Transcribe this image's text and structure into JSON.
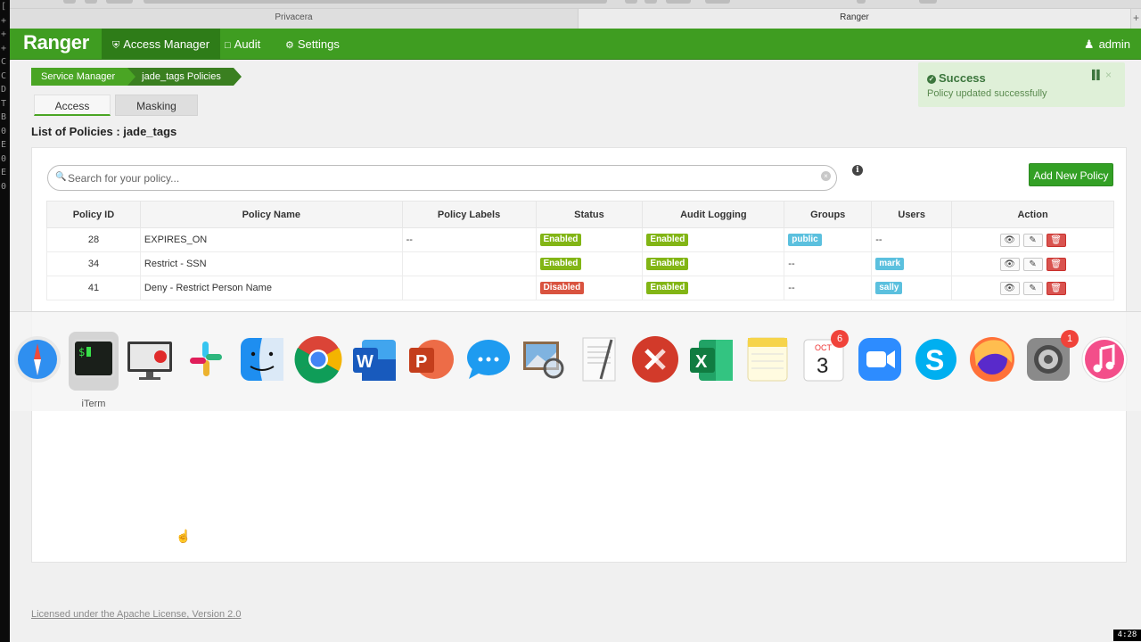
{
  "terminal": {
    "left_chars": [
      "[",
      "+",
      "+",
      "+",
      "C",
      "C",
      "D",
      "T",
      "B",
      "0",
      "E",
      "0",
      "E",
      "0"
    ]
  },
  "browser": {
    "tabs": [
      {
        "label": "Privacera"
      },
      {
        "label": "Ranger"
      }
    ],
    "new_tab_label": "+"
  },
  "navbar": {
    "brand": "Ranger",
    "items": [
      {
        "label": "Access Manager"
      },
      {
        "label": "Audit"
      },
      {
        "label": "Settings"
      }
    ],
    "user": "admin"
  },
  "breadcrumb": {
    "items": [
      {
        "label": "Service Manager"
      },
      {
        "label": "jade_tags Policies"
      }
    ]
  },
  "tabs": {
    "access": "Access",
    "masking": "Masking"
  },
  "list_title": "List of Policies : jade_tags",
  "toast": {
    "title": "Success",
    "message": "Policy updated successfully"
  },
  "search": {
    "placeholder": "Search for your policy...",
    "value": ""
  },
  "add_button": "Add New Policy",
  "table": {
    "headers": [
      "Policy ID",
      "Policy Name",
      "Policy Labels",
      "Status",
      "Audit Logging",
      "Groups",
      "Users",
      "Action"
    ],
    "rows": [
      {
        "id": "28",
        "name": "EXPIRES_ON",
        "labels": "--",
        "status": "Enabled",
        "audit": "Enabled",
        "groups": "public",
        "users": "--"
      },
      {
        "id": "34",
        "name": "Restrict - SSN",
        "labels": "",
        "status": "Enabled",
        "audit": "Enabled",
        "groups": "--",
        "users": "mark"
      },
      {
        "id": "41",
        "name": "Deny - Restrict Person Name",
        "labels": "",
        "status": "Disabled",
        "audit": "Enabled",
        "groups": "--",
        "users": "sally"
      }
    ]
  },
  "dock": {
    "selected_label": "iTerm",
    "apps": [
      {
        "icon": "safari-icon"
      },
      {
        "icon": "iterm-icon"
      },
      {
        "icon": "screen-recorder-icon"
      },
      {
        "icon": "slack-icon"
      },
      {
        "icon": "finder-icon"
      },
      {
        "icon": "chrome-icon"
      },
      {
        "icon": "word-icon"
      },
      {
        "icon": "powerpoint-icon"
      },
      {
        "icon": "messages-icon"
      },
      {
        "icon": "preview-icon"
      },
      {
        "icon": "textedit-icon"
      },
      {
        "icon": "remote-desktop-icon"
      },
      {
        "icon": "excel-icon"
      },
      {
        "icon": "notes-icon"
      },
      {
        "icon": "calendar-icon"
      },
      {
        "icon": "zoom-icon"
      },
      {
        "icon": "skype-icon"
      },
      {
        "icon": "firefox-icon"
      },
      {
        "icon": "system-preferences-icon"
      },
      {
        "icon": "itunes-icon"
      }
    ],
    "calendar": {
      "month": "OCT",
      "day": "3",
      "badge": "6"
    },
    "syspref_badge": "1"
  },
  "footer": {
    "license": "Licensed under the Apache License, Version 2.0"
  },
  "video_time": "4:28",
  "colors": {
    "nav_green": "#3f9d21",
    "success_bg": "#dff0d8",
    "enabled": "#82b515",
    "disabled": "#d9533f",
    "user_badge": "#5bc0de"
  }
}
